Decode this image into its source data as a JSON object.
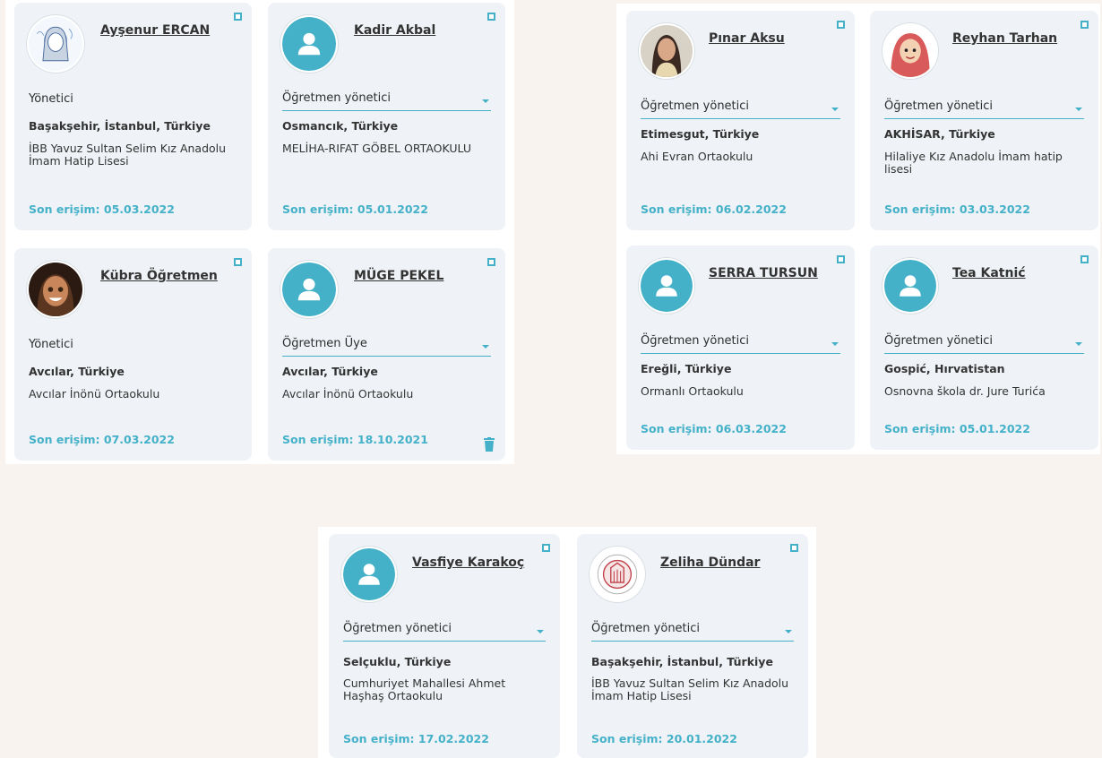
{
  "colors": {
    "accent": "#45b1c9",
    "card_bg": "#eff3f7",
    "page_bg": "#f8f3ef"
  },
  "panels": [
    {
      "cards": [
        {
          "name": "Ayşenur ERCAN",
          "avatar": "drawing-avatar",
          "role": "Yönetici",
          "role_editable": false,
          "location": "Başakşehir, İstanbul, Türkiye",
          "school": "İBB Yavuz Sultan Selim Kız Anadolu İmam Hatip Lisesi",
          "last_access": "Son erişim: 05.03.2022"
        },
        {
          "name": "Kadir Akbal",
          "avatar": "default-user-avatar",
          "role": "Öğretmen yönetici",
          "role_editable": true,
          "location": "Osmancık, Türkiye",
          "school": "MELİHA-RIFAT GÖBEL ORTAOKULU",
          "last_access": "Son erişim: 05.01.2022"
        },
        {
          "name": "Kübra Öğretmen",
          "avatar": "cartoon-avatar",
          "role": "Yönetici",
          "role_editable": false,
          "location": "Avcılar, Türkiye",
          "school": "Avcılar İnönü Ortaokulu",
          "last_access": "Son erişim: 07.03.2022"
        },
        {
          "name": "MÜGE PEKEL",
          "avatar": "default-user-avatar",
          "role": "Öğretmen Üye",
          "role_editable": true,
          "location": "Avcılar, Türkiye",
          "school": "Avcılar İnönü Ortaokulu",
          "last_access": "Son erişim: 18.10.2021",
          "has_delete": true
        }
      ]
    },
    {
      "cards": [
        {
          "name": "Pınar Aksu",
          "avatar": "photo-avatar",
          "role": "Öğretmen yönetici",
          "role_editable": true,
          "location": "Etimesgut, Türkiye",
          "school": "Ahi Evran Ortaokulu",
          "last_access": "Son erişim: 06.02.2022"
        },
        {
          "name": "Reyhan Tarhan",
          "avatar": "cartoon-avatar",
          "role": "Öğretmen yönetici",
          "role_editable": true,
          "location": "AKHİSAR, Türkiye",
          "school": "Hilaliye Kız Anadolu İmam hatip lisesi",
          "last_access": "Son erişim: 03.03.2022"
        },
        {
          "name": "SERRA TURSUN",
          "avatar": "default-user-avatar",
          "role": "Öğretmen yönetici",
          "role_editable": true,
          "location": "Ereğli, Türkiye",
          "school": "Ormanlı Ortaokulu",
          "last_access": "Son erişim: 06.03.2022"
        },
        {
          "name": "Tea Katnić",
          "avatar": "default-user-avatar",
          "role": "Öğretmen yönetici",
          "role_editable": true,
          "location": "Gospić, Hırvatistan",
          "school": "Osnovna škola dr. Jure Turića",
          "last_access": "Son erişim: 05.01.2022"
        }
      ]
    },
    {
      "cards": [
        {
          "name": "Vasfiye Karakoç",
          "avatar": "default-user-avatar",
          "role": "Öğretmen yönetici",
          "role_editable": true,
          "location": "Selçuklu, Türkiye",
          "school": "Cumhuriyet Mahallesi Ahmet Haşhaş Ortaokulu",
          "last_access": "Son erişim: 17.02.2022"
        },
        {
          "name": "Zeliha Dündar",
          "avatar": "school-logo-avatar",
          "role": "Öğretmen yönetici",
          "role_editable": true,
          "location": "Başakşehir, İstanbul, Türkiye",
          "school": "İBB Yavuz Sultan Selim Kız Anadolu İmam Hatip Lisesi",
          "last_access": "Son erişim: 20.01.2022"
        }
      ]
    }
  ]
}
